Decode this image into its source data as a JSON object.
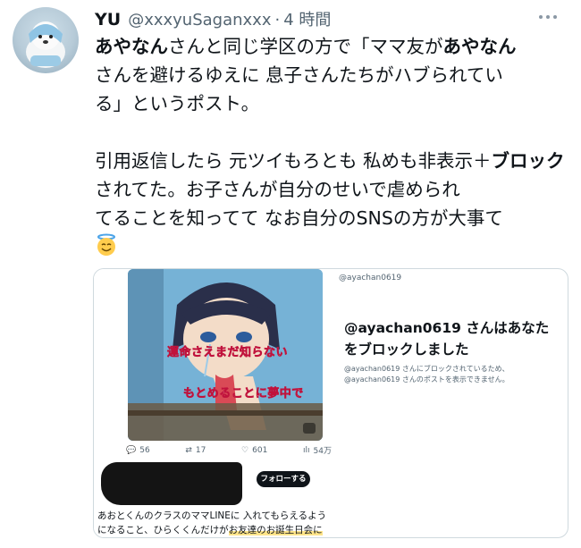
{
  "tweet": {
    "display_name": "YU",
    "handle": "@xxxyuSaganxxx",
    "separator": "·",
    "time": "4 時間",
    "line1_a": "あやなん",
    "line1_b": "さんと同じ学区の方で「ママ友が",
    "line1_c": "あやなん",
    "line2": "さんを避けるゆえに 息子さんたちがハブられてい",
    "line3": "る」というポスト。",
    "para2_a": "引用返信したら 元ツイもろとも 私めも非表示＋",
    "para2_b": "ブロック",
    "para2_c": "されてた。お子さんが自分のせいで虐められ",
    "para2_d": "てることを知ってて なお自分のSNSの方が大事て",
    "emoji": "smiling-face-with-halo"
  },
  "quoted_image": {
    "left_post": {
      "lyrics_line1": "運命さえまだ知らない",
      "lyrics_line2": "もとめることに夢中で",
      "replies": "56",
      "reposts": "17",
      "likes": "601",
      "views": "54万",
      "follow_label": "フォローする",
      "snippet_line1": "あおとくんのクラスのママLINEに 入れてもらえるよう",
      "snippet_line2_a": "になること、ひらくくんだけが",
      "snippet_line2_b": "お友達のお誕生日会に"
    },
    "right_post": {
      "handle": "@ayachan0619",
      "title": "@ayachan0619 さんはあなたをブロックしました",
      "subtitle": "@ayachan0619 さんにブロックされているため、@ayachan0619 さんのポストを表示できません。"
    }
  }
}
